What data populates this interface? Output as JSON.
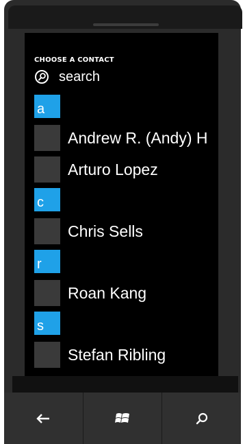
{
  "header": {
    "title": "CHOOSE A CONTACT"
  },
  "search": {
    "label": "search",
    "icon": "search-icon"
  },
  "groups": [
    {
      "letter": "a",
      "contacts": [
        {
          "name": "Andrew R. (Andy) H"
        },
        {
          "name": "Arturo Lopez"
        }
      ]
    },
    {
      "letter": "c",
      "contacts": [
        {
          "name": "Chris Sells"
        }
      ]
    },
    {
      "letter": "r",
      "contacts": [
        {
          "name": "Roan Kang"
        }
      ]
    },
    {
      "letter": "s",
      "contacts": [
        {
          "name": "Stefan Ribling"
        }
      ]
    }
  ],
  "navbar": {
    "back_icon": "back-arrow-icon",
    "start_icon": "windows-logo-icon",
    "search_icon": "search-icon"
  },
  "colors": {
    "accent": "#1fa1e8",
    "screen_bg": "#000000",
    "avatar_placeholder": "#3a3a3a"
  }
}
